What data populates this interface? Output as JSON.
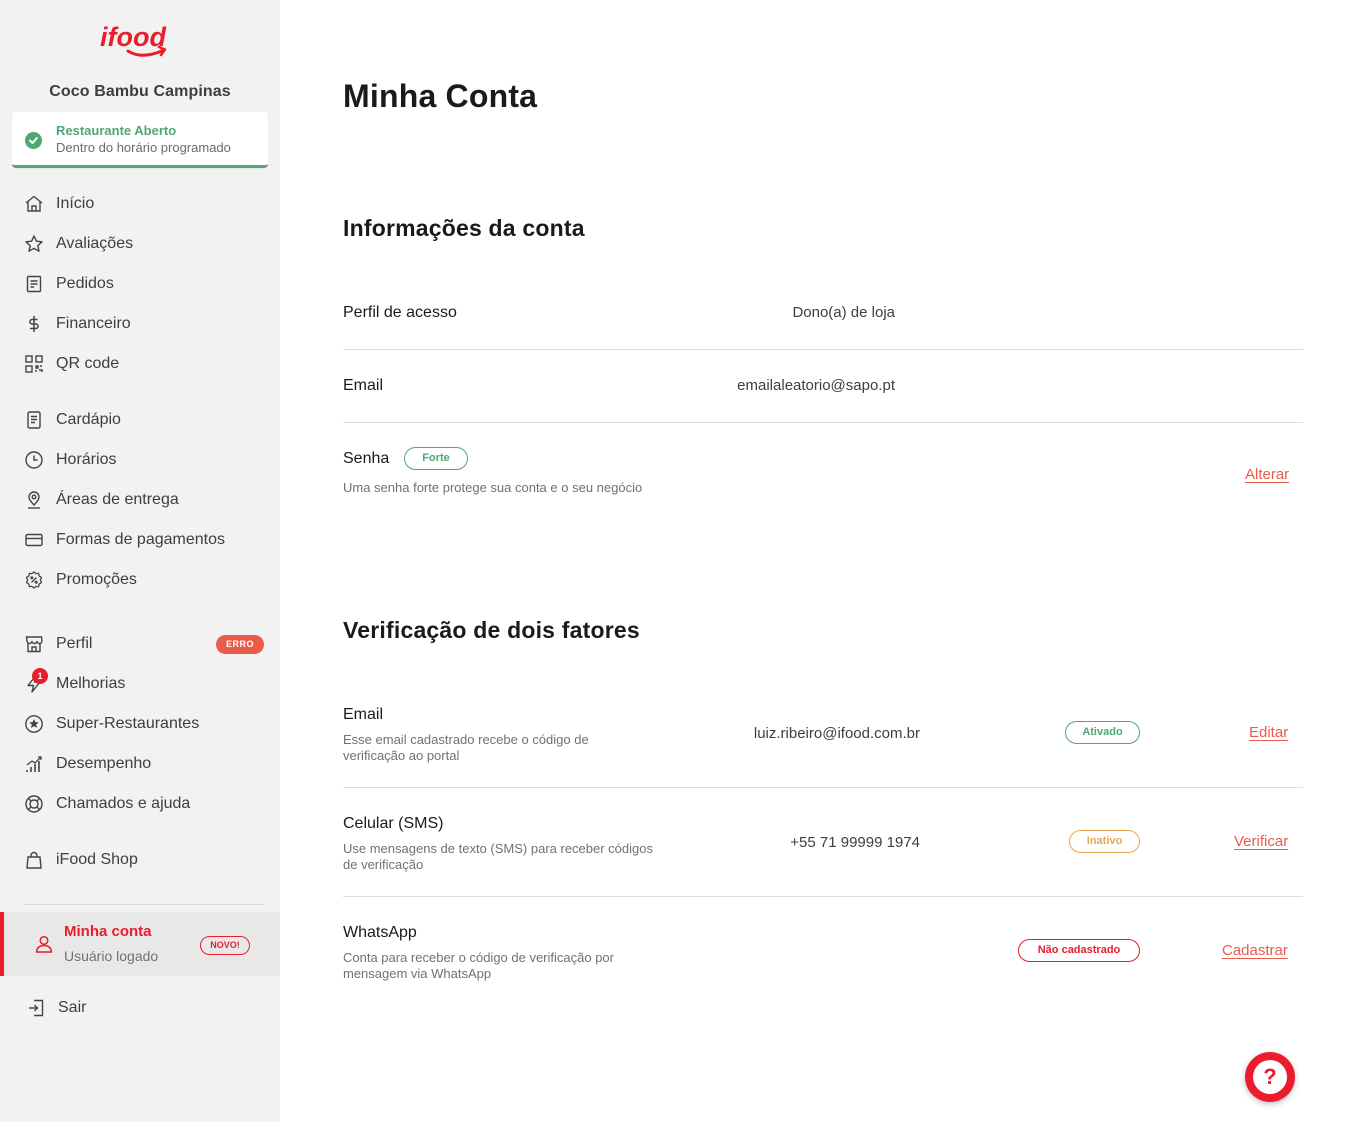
{
  "sidebar": {
    "logo_text": "ifood",
    "store_name": "Coco Bambu Campinas",
    "status": {
      "title": "Restaurante Aberto",
      "subtitle": "Dentro do horário programado"
    },
    "items": [
      {
        "label": "Início",
        "icon": "home-icon"
      },
      {
        "label": "Avaliações",
        "icon": "star-icon"
      },
      {
        "label": "Pedidos",
        "icon": "receipt-icon"
      },
      {
        "label": "Financeiro",
        "icon": "dollar-icon"
      },
      {
        "label": "QR code",
        "icon": "qr-code-icon"
      },
      {
        "label": "Cardápio",
        "icon": "menu-book-icon"
      },
      {
        "label": "Horários",
        "icon": "clock-icon"
      },
      {
        "label": "Áreas de entrega",
        "icon": "map-pin-icon"
      },
      {
        "label": "Formas de pagamentos",
        "icon": "credit-card-icon"
      },
      {
        "label": "Promoções",
        "icon": "discount-icon"
      },
      {
        "label": "Perfil",
        "icon": "store-icon",
        "badge": "ERRO"
      },
      {
        "label": "Melhorias",
        "icon": "lightning-icon",
        "notification": "1"
      },
      {
        "label": "Super-Restaurantes",
        "icon": "star-circle-icon"
      },
      {
        "label": "Desempenho",
        "icon": "bar-chart-icon"
      },
      {
        "label": "Chamados e ajuda",
        "icon": "lifebuoy-icon"
      },
      {
        "label": "iFood Shop",
        "icon": "shopping-bag-icon"
      }
    ],
    "account": {
      "title": "Minha conta",
      "subtitle": "Usuário logado",
      "badge": "NOVO!"
    },
    "logout": "Sair"
  },
  "main": {
    "title": "Minha Conta",
    "account_info": {
      "heading": "Informações da conta",
      "profile_label": "Perfil de acesso",
      "profile_value": "Dono(a) de loja",
      "email_label": "Email",
      "email_value": "emailaleatorio@sapo.pt",
      "password_label": "Senha",
      "password_badge": "Forte",
      "password_desc": "Uma senha forte protege sua conta e o seu negócio",
      "password_action": "Alterar"
    },
    "two_factor": {
      "heading": "Verificação de dois fatores",
      "rows": [
        {
          "label": "Email",
          "desc": "Esse email cadastrado recebe o código de verificação ao portal",
          "value": "luiz.ribeiro@ifood.com.br",
          "status": "Ativado",
          "action": "Editar"
        },
        {
          "label": "Celular (SMS)",
          "desc": "Use mensagens de texto (SMS) para receber códigos de verificação",
          "value": "+55 71 99999 1974",
          "status": "Inativo",
          "action": "Verificar"
        },
        {
          "label": "WhatsApp",
          "desc": "Conta para receber o código de verificação por mensagem via WhatsApp",
          "value": "",
          "status": "Não cadastrado",
          "action": "Cadastrar"
        }
      ]
    },
    "help_symbol": "?"
  },
  "colors": {
    "brand_red": "#ea1d2c",
    "success_green": "#50a773",
    "warning_orange": "#e7a74e",
    "link_coral": "#ea5b4a",
    "sidebar_bg": "#f2f2f2"
  }
}
